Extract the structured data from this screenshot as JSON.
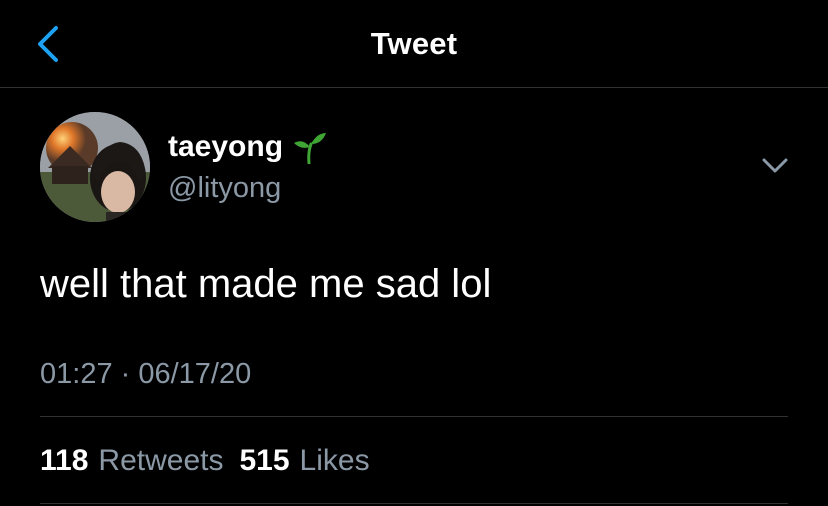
{
  "header": {
    "title": "Tweet",
    "back_icon": "chevron-left-icon"
  },
  "colors": {
    "accent": "#1da1f2",
    "background": "#000000",
    "secondary_text": "#8b98a5",
    "divider": "#2f3336",
    "sprout_green": "#3fa535"
  },
  "tweet": {
    "author": {
      "display_name": "taeyong",
      "name_emoji_icon": "seedling-icon",
      "handle": "@lityong"
    },
    "more_icon": "chevron-down-icon",
    "text": "well that made me sad lol",
    "timestamp": "01:27 · 06/17/20",
    "stats": {
      "retweets_count": "118",
      "retweets_label": "Retweets",
      "likes_count": "515",
      "likes_label": "Likes"
    }
  }
}
